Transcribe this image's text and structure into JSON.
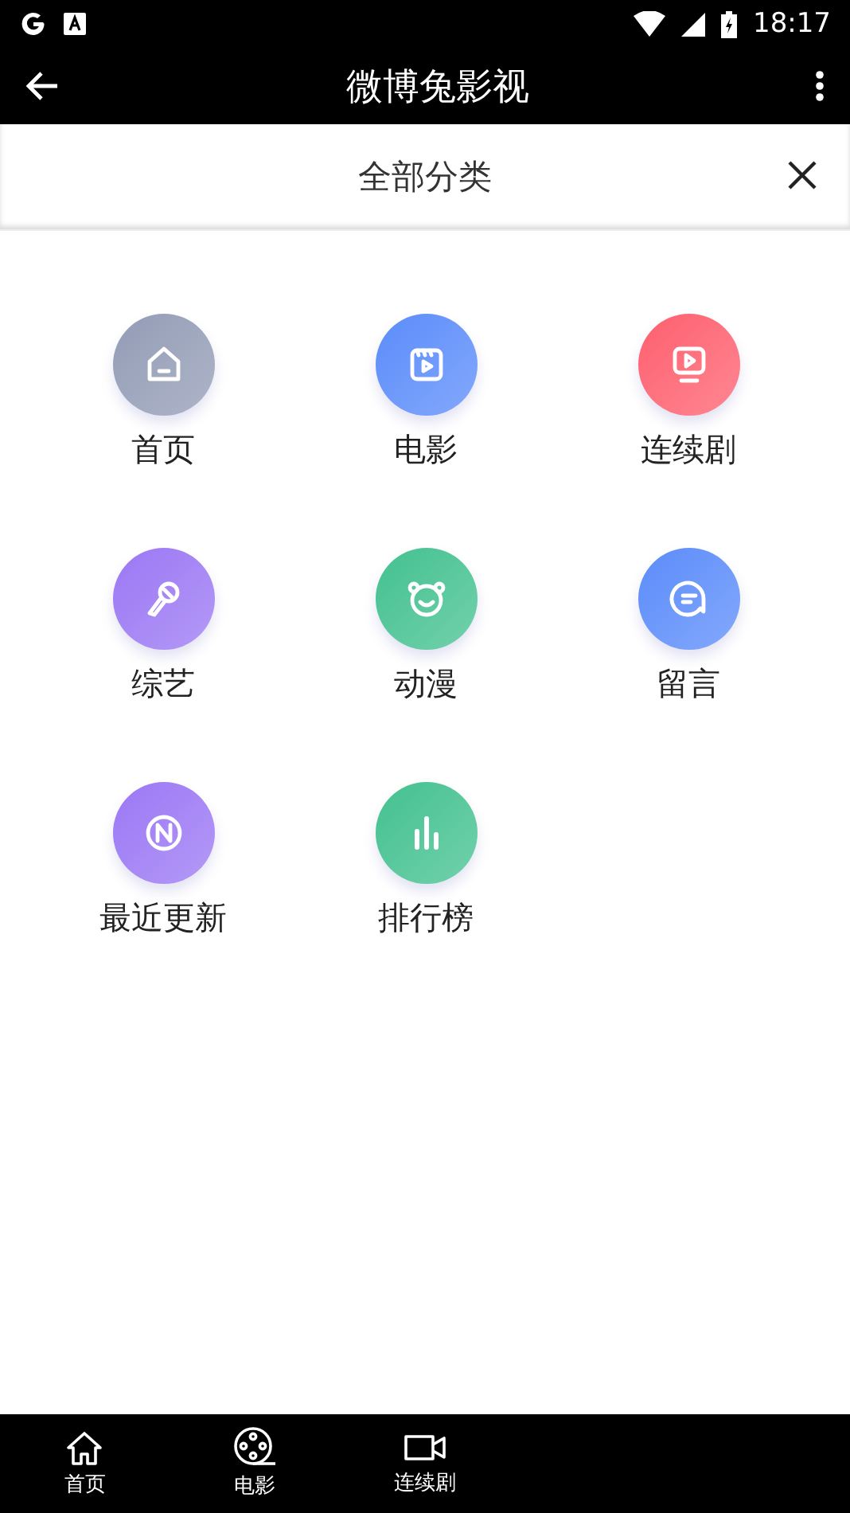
{
  "status_bar": {
    "time": "18:17"
  },
  "app_bar": {
    "title": "微博兔影视"
  },
  "panel": {
    "title": "全部分类"
  },
  "categories": [
    {
      "label": "首页",
      "kind": "home",
      "color": "#939cb6"
    },
    {
      "label": "电影",
      "kind": "film",
      "color": "#5b8cfa"
    },
    {
      "label": "连续剧",
      "kind": "tv",
      "color": "#fe5f6e"
    },
    {
      "label": "综艺",
      "kind": "mic",
      "color": "#9b77f4"
    },
    {
      "label": "动漫",
      "kind": "bear",
      "color": "#43c18f"
    },
    {
      "label": "留言",
      "kind": "chat",
      "color": "#5b8cfa"
    },
    {
      "label": "最近更新",
      "kind": "new",
      "color": "#9b77f4"
    },
    {
      "label": "排行榜",
      "kind": "chart",
      "color": "#43c18f"
    }
  ],
  "bottom_nav": [
    {
      "label": "首页",
      "kind": "home"
    },
    {
      "label": "电影",
      "kind": "reel"
    },
    {
      "label": "连续剧",
      "kind": "camera"
    }
  ]
}
